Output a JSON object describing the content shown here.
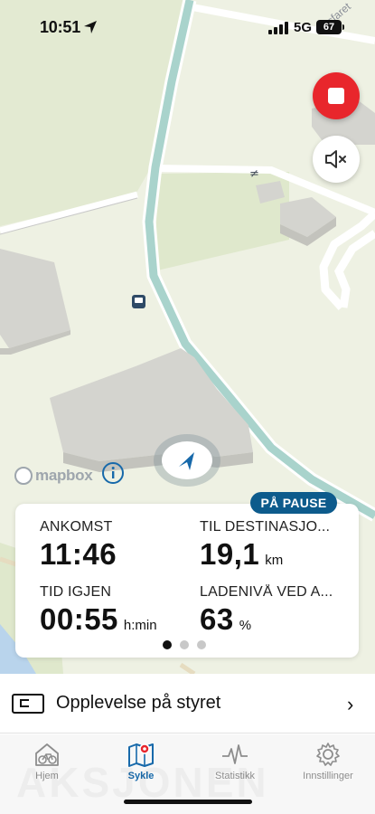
{
  "status_bar": {
    "time": "10:51",
    "network": "5G",
    "battery": "67"
  },
  "map": {
    "attribution": "mapbox",
    "street_label": "Åsfaret"
  },
  "recording": {
    "badge": "PÅ PAUSE"
  },
  "stats": {
    "arrival_label": "ANKOMST",
    "arrival_value": "11:46",
    "distance_label": "TIL DESTINASJO...",
    "distance_value": "19,1",
    "distance_unit": "km",
    "time_left_label": "TID IGJEN",
    "time_left_value": "00:55",
    "time_left_unit": "h:min",
    "battery_label": "LADENIVÅ VED A...",
    "battery_value": "63",
    "battery_unit": "%"
  },
  "pager": {
    "pages": 3,
    "active": 1
  },
  "cockpit": {
    "label": "Opplevelse på styret"
  },
  "tabs": [
    {
      "label": "Hjem",
      "icon": "bike-home-icon"
    },
    {
      "label": "Sykle",
      "icon": "map-pin-icon"
    },
    {
      "label": "Statistikk",
      "icon": "pulse-icon"
    },
    {
      "label": "Innstillinger",
      "icon": "gear-icon"
    }
  ],
  "watermark": "AKSJONEN",
  "colors": {
    "accent": "#1769aa",
    "stop": "#e8262c",
    "badge": "#0d5b8c",
    "route": "#a9d3cc"
  }
}
